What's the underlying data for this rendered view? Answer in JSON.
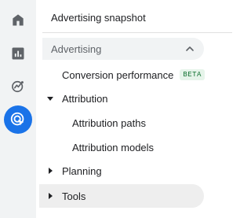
{
  "rail": {
    "icons": [
      {
        "name": "home-icon",
        "selected": false
      },
      {
        "name": "reports-icon",
        "selected": false
      },
      {
        "name": "explore-icon",
        "selected": false
      },
      {
        "name": "advertising-icon",
        "selected": true
      }
    ],
    "accent": "#1a73e8"
  },
  "nav": {
    "snapshot_label": "Advertising snapshot",
    "advertising_header": "Advertising",
    "conversion_label": "Conversion performance",
    "beta_badge": "BETA",
    "attribution_label": "Attribution",
    "attribution_paths_label": "Attribution paths",
    "attribution_models_label": "Attribution models",
    "planning_label": "Planning",
    "tools_label": "Tools"
  }
}
